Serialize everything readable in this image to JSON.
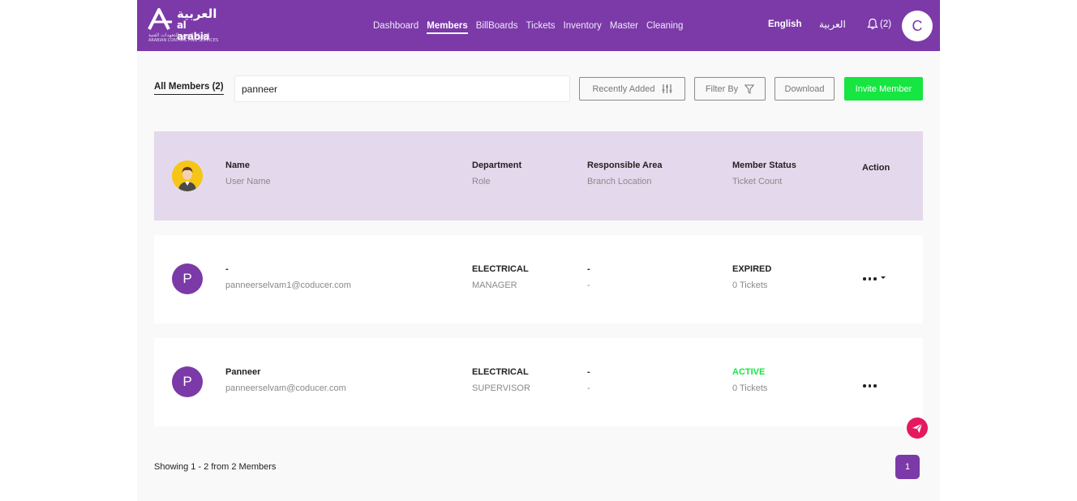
{
  "brand": {
    "name_ar": "العربية",
    "name_en": "al arabia",
    "tagline_ar": "الشركة العربية للتعهدات الفنية",
    "tagline_en": "ARABIAN CONTRACTING SERVICES"
  },
  "nav": {
    "items": [
      {
        "label": "Dashboard",
        "active": false
      },
      {
        "label": "Members",
        "active": true
      },
      {
        "label": "BillBoards",
        "active": false
      },
      {
        "label": "Tickets",
        "active": false
      },
      {
        "label": "Inventory",
        "active": false
      },
      {
        "label": "Master",
        "active": false
      },
      {
        "label": "Cleaning",
        "active": false
      }
    ],
    "lang_en": "English",
    "lang_ar": "العربية",
    "notifications": "(2)",
    "user_initial": "C"
  },
  "toolbar": {
    "tab_all": "All Members (2)",
    "search_value": "panneer",
    "sort_label": "Recently Added",
    "filter_label": "Filter By",
    "download_label": "Download",
    "invite_label": "Invite Member"
  },
  "table": {
    "header": {
      "name": "Name",
      "name_sub": "User Name",
      "dept": "Department",
      "dept_sub": "Role",
      "area": "Responsible Area",
      "area_sub": "Branch Location",
      "status": "Member Status",
      "status_sub": "Ticket Count",
      "action": "Action"
    },
    "rows": [
      {
        "initial": "P",
        "name": "-",
        "email": "panneerselvam1@coducer.com",
        "dept": "ELECTRICAL",
        "role": "MANAGER",
        "area": "-",
        "branch": "-",
        "status": "EXPIRED",
        "tickets": "0 Tickets"
      },
      {
        "initial": "P",
        "name": "Panneer",
        "email": "panneerselvam@coducer.com",
        "dept": "ELECTRICAL",
        "role": "SUPERVISOR",
        "area": "-",
        "branch": "-",
        "status": "ACTIVE",
        "tickets": "0 Tickets"
      }
    ]
  },
  "footer": {
    "showing": "Showing 1 - 2 from 2 Members",
    "page": "1"
  },
  "colors": {
    "brand_purple": "#7b3aa8",
    "header_row": "#e4d8ec",
    "accent_green": "#16e542",
    "fab_pink": "#e5195f"
  },
  "icons": [
    "logo-mark-icon",
    "bell-icon",
    "sliders-icon",
    "filter-funnel-icon",
    "more-dots-icon",
    "dropdown-caret-icon",
    "send-plane-icon",
    "user-avatar-icon"
  ]
}
